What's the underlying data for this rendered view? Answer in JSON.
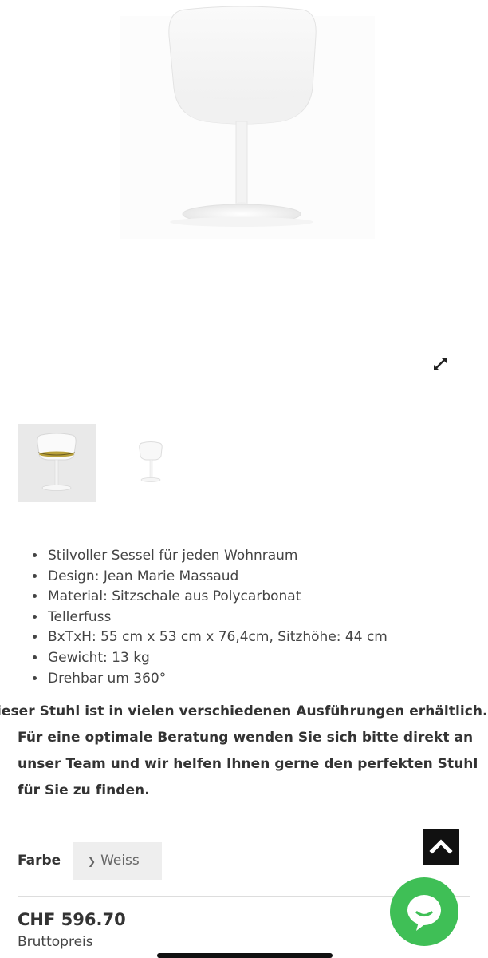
{
  "product": {
    "expand_icon": "expand-arrows-icon",
    "features": [
      "Stilvoller Sessel für jeden Wohnraum",
      "Design: Jean Marie Massaud",
      "Material: Sitzschale aus Polycarbonat",
      "Tellerfuss",
      "BxTxH: 55 cm x 53 cm x 76,4cm, Sitzhöhe: 44 cm",
      "Gewicht: 13 kg",
      "Drehbar um 360°"
    ],
    "notice_lines": [
      "ieser Stuhl ist in vielen verschiedenen Ausführungen erhältlich.",
      "Für eine optimale Beratung wenden Sie sich bitte direkt an",
      "unser Team und wir helfen Ihnen gerne den perfekten Stuhl",
      "für Sie zu finden."
    ],
    "color_label": "Farbe",
    "color_value": "Weiss",
    "price": "CHF 596.70",
    "price_note": "Bruttopreis"
  },
  "colors": {
    "chat_green": "#3fbf56",
    "back_to_top_bg": "#111111",
    "select_bg": "#eeeeee"
  }
}
